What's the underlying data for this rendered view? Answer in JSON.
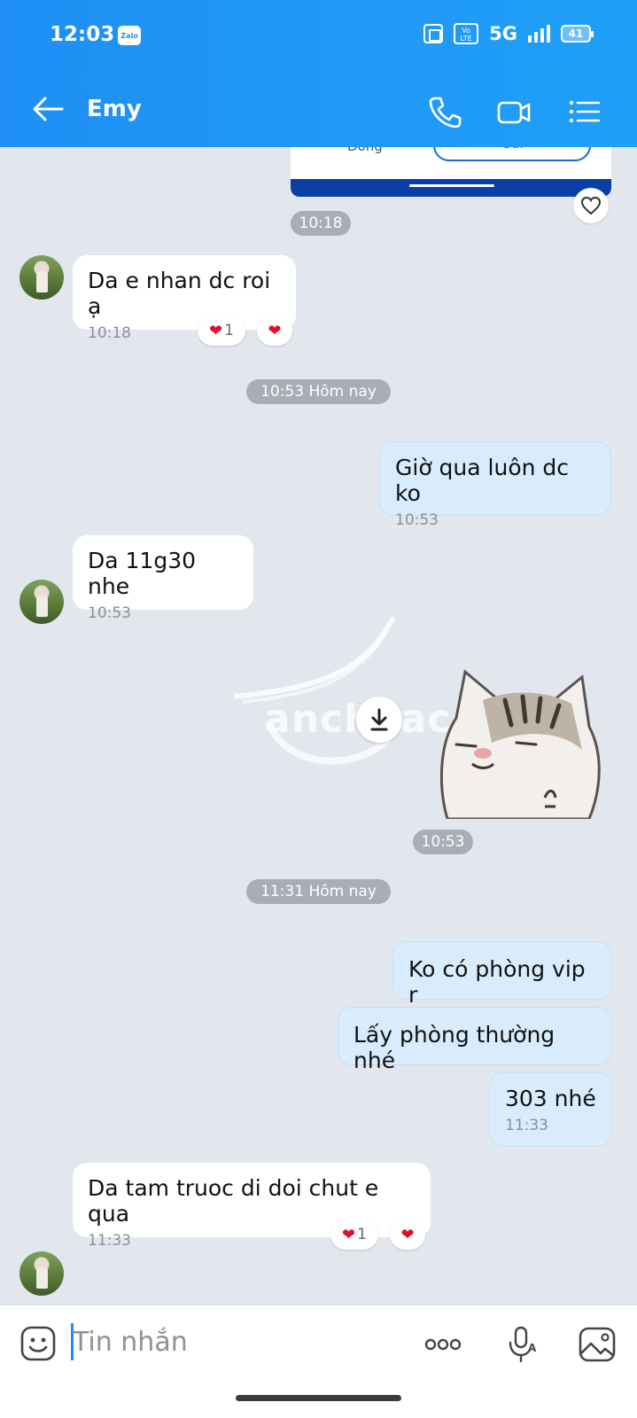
{
  "status_bar": {
    "time": "12:03",
    "app_badge": "Zalo",
    "volte": "Vo LTE",
    "network": "5G",
    "battery": "41"
  },
  "header": {
    "title": "Emy",
    "icons": [
      "back-arrow-icon",
      "phone-icon",
      "video-call-icon",
      "menu-list-icon"
    ]
  },
  "card_preview": {
    "left_label": "Đóng",
    "button_label": "Gửi"
  },
  "messages": [
    {
      "type": "time_pill",
      "text": "10:18"
    },
    {
      "type": "in",
      "text": "Da e nhan dc roi ạ",
      "time": "10:18",
      "reaction_count": "1"
    },
    {
      "type": "time_pill",
      "text": "10:53 Hôm nay"
    },
    {
      "type": "out",
      "text": "Giờ qua luôn dc ko",
      "time": "10:53"
    },
    {
      "type": "in",
      "text": "Da 11g30 nhe",
      "time": "10:53"
    },
    {
      "type": "sticker",
      "watermark": "anchoac"
    },
    {
      "type": "time_pill",
      "text": "10:53"
    },
    {
      "type": "time_pill",
      "text": "11:31 Hôm nay"
    },
    {
      "type": "out",
      "text": "Ko có phòng vip r"
    },
    {
      "type": "out",
      "text": "Lấy phòng thường nhé"
    },
    {
      "type": "out",
      "text": "303 nhé",
      "time": "11:33"
    },
    {
      "type": "in",
      "text": "Da tam truoc di doi chut e qua",
      "time": "11:33",
      "reaction_count": "1"
    }
  ],
  "composer": {
    "placeholder": "Tin nhắn"
  },
  "colors": {
    "header": "#1f8ff5",
    "bubble_out": "#d8ecfc",
    "bubble_in": "#ffffff",
    "background": "#e2e7ee"
  }
}
